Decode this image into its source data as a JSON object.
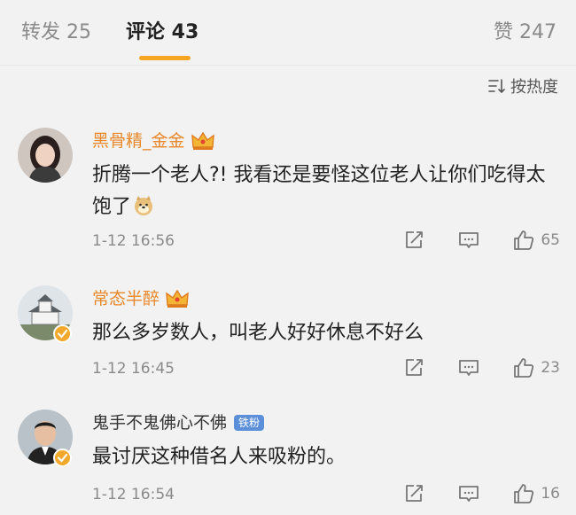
{
  "tabs": {
    "repost": "转发 25",
    "comments": "评论 43",
    "likes": "赞 247"
  },
  "sort": {
    "label": "按热度",
    "icon": "sort-icon"
  },
  "comments": [
    {
      "name": "黑骨精_金金",
      "vip": true,
      "text": "折腾一个老人?! 我看还是要怪这位老人让你们吃得太饱了",
      "emoji": "doge-emoji",
      "time": "1-12 16:56",
      "likes": "65"
    },
    {
      "name": "常态半醉",
      "vip": true,
      "verified": true,
      "text": "那么多岁数人，叫老人好好休息不好么",
      "time": "1-12 16:45",
      "likes": "23"
    },
    {
      "name": "鬼手不鬼佛心不佛",
      "vip": false,
      "verified": true,
      "tag": "铁粉",
      "text": "最讨厌这种借名人来吸粉的。",
      "time": "1-12 16:54",
      "likes": "16"
    }
  ],
  "colors": {
    "accent": "#f6a623",
    "vip_name": "#e8882a",
    "fan_tag": "#5b8fd9"
  }
}
